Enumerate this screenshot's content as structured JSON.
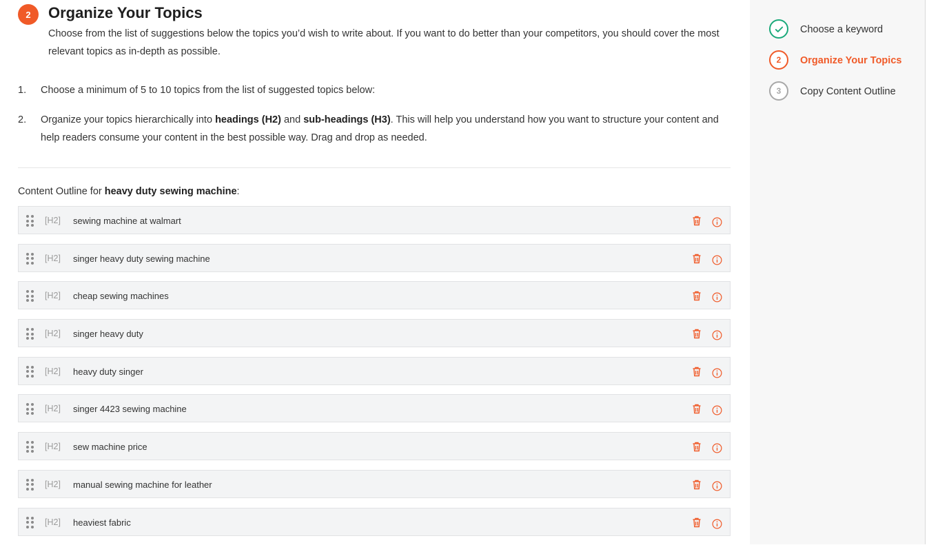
{
  "header": {
    "step_number": "2",
    "title": "Organize Your Topics",
    "intro": "Choose from the list of suggestions below the topics you’d wish to write about. If you want to do better than your competitors, you should cover the most relevant topics as in-depth as possible."
  },
  "instructions": {
    "step1_number": "1.",
    "step1_text": "Choose a minimum of 5 to 10 topics from the list of suggested topics below:",
    "step2_number": "2.",
    "step2_part1": "Organize your topics hierarchically into ",
    "step2_bold1": "headings (H2)",
    "step2_part2": " and ",
    "step2_bold2": "sub-headings (H3)",
    "step2_part3": ". This will help you understand how you want to structure your content and help readers consume your content in the best possible way. Drag and drop as needed."
  },
  "outline": {
    "label_prefix": "Content Outline for ",
    "keyword": "heavy duty sewing machine",
    "label_suffix": ":",
    "topics": [
      {
        "level": "[H2]",
        "text": "sewing machine at walmart"
      },
      {
        "level": "[H2]",
        "text": "singer heavy duty sewing machine"
      },
      {
        "level": "[H2]",
        "text": "cheap sewing machines"
      },
      {
        "level": "[H2]",
        "text": "singer heavy duty"
      },
      {
        "level": "[H2]",
        "text": "heavy duty singer"
      },
      {
        "level": "[H2]",
        "text": "singer 4423 sewing machine"
      },
      {
        "level": "[H2]",
        "text": "sew machine price"
      },
      {
        "level": "[H2]",
        "text": "manual sewing machine for leather"
      },
      {
        "level": "[H2]",
        "text": "heaviest fabric"
      }
    ]
  },
  "wizard": {
    "steps": [
      {
        "label": "Choose a keyword",
        "status": "done",
        "number": ""
      },
      {
        "label": "Organize Your Topics",
        "status": "active",
        "number": "2"
      },
      {
        "label": "Copy Content Outline",
        "status": "pending",
        "number": "3"
      }
    ]
  },
  "icons": {
    "drag": "drag-handle-icon",
    "delete": "trash-icon",
    "info": "info-icon",
    "done": "checkmark-icon"
  },
  "colors": {
    "accent": "#f05a28",
    "success": "#1aa97a",
    "pending": "#a8a8a8",
    "row_bg": "#f3f4f5"
  }
}
